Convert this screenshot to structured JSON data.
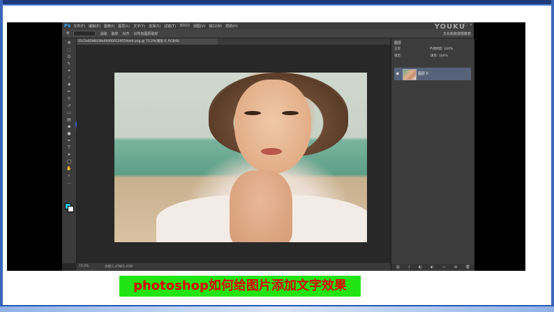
{
  "app": {
    "logo": "Ps",
    "menu": [
      "文件(F)",
      "编辑(E)",
      "图像(I)",
      "图层(L)",
      "文字(Y)",
      "选择(S)",
      "滤镜(T)",
      "3D(D)",
      "视图(V)",
      "窗口(W)",
      "帮助(H)"
    ],
    "watermark": "YOUKU",
    "window_controls": [
      "–",
      "□",
      "×"
    ],
    "workspace_label": "文化和旅游部教育"
  },
  "options_bar": {
    "tool_label": "消除",
    "items": [
      "取样",
      "对齐",
      "对所有图层取样"
    ]
  },
  "document": {
    "tab_title": "01c5e8598439a000000129559de0.png @ 73.2%(图层 0, RGB/8)"
  },
  "toolbar": {
    "tools": [
      "move-tool",
      "marquee-tool",
      "lasso-tool",
      "quick-select-tool",
      "crop-tool",
      "eyedropper-tool",
      "healing-brush-tool",
      "brush-tool",
      "clone-stamp-tool",
      "history-brush-tool",
      "eraser-tool",
      "gradient-tool",
      "blur-tool",
      "dodge-tool",
      "pen-tool",
      "type-tool",
      "path-select-tool",
      "shape-tool",
      "hand-tool",
      "zoom-tool"
    ],
    "foreground_color": "#21c8e8",
    "background_color": "#ffffff"
  },
  "status_bar": {
    "zoom": "73.2%",
    "doc_info": "文档:1.47M/1.47M"
  },
  "layers_panel": {
    "title": "图层",
    "blend_mode": "正常",
    "opacity_label": "不透明度:",
    "opacity": "100%",
    "lock_label": "锁定:",
    "fill_label": "填充:",
    "fill": "100%",
    "layer_name": "图层 0"
  },
  "caption": "photoshop如何给图片添加文字效果"
}
